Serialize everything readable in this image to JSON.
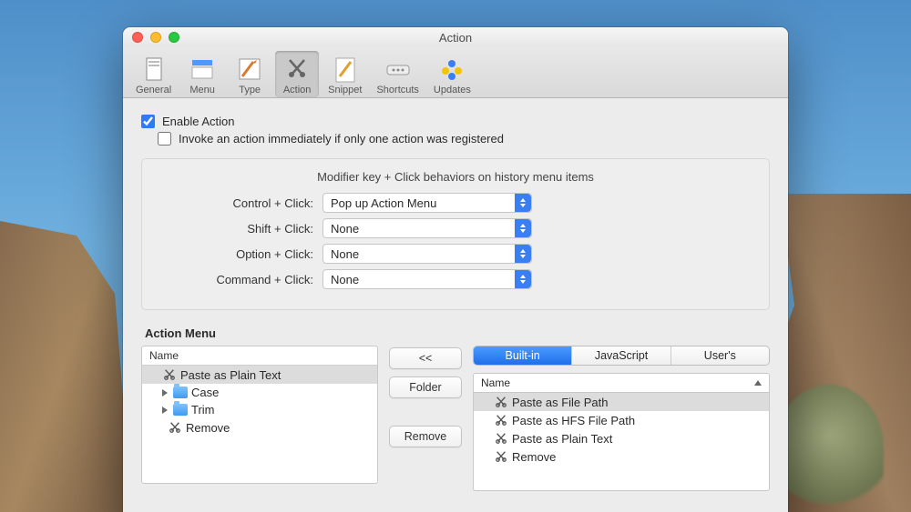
{
  "window": {
    "title": "Action"
  },
  "toolbar": {
    "items": [
      "General",
      "Menu",
      "Type",
      "Action",
      "Snippet",
      "Shortcuts",
      "Updates"
    ],
    "active": "Action"
  },
  "checks": {
    "enable": "Enable Action",
    "invoke": "Invoke an action immediately if only one action was registered"
  },
  "modifiers": {
    "heading": "Modifier key + Click behaviors on history menu items",
    "control_label": "Control + Click:",
    "control_value": "Pop up Action Menu",
    "shift_label": "Shift + Click:",
    "shift_value": "None",
    "option_label": "Option + Click:",
    "option_value": "None",
    "command_label": "Command + Click:",
    "command_value": "None"
  },
  "action_menu": {
    "title": "Action Menu",
    "name_col": "Name",
    "items": {
      "paste_plain": "Paste as Plain Text",
      "case": "Case",
      "trim": "Trim",
      "remove": "Remove"
    }
  },
  "buttons": {
    "back": "<<",
    "folder": "Folder",
    "remove": "Remove"
  },
  "tabs": {
    "builtin": "Built-in",
    "js": "JavaScript",
    "users": "User's"
  },
  "right": {
    "name_col": "Name",
    "items": {
      "file_path": "Paste as File Path",
      "hfs_path": "Paste as HFS File Path",
      "plain": "Paste as Plain Text",
      "remove": "Remove"
    }
  }
}
